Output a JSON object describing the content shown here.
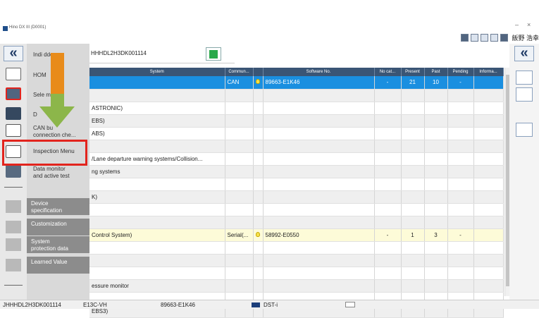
{
  "titlebar": {
    "title": "Hino DX III (D0001)",
    "minimize": "–",
    "close": "×"
  },
  "header_right": {
    "user": "飯野 浩幸"
  },
  "sidebar": {
    "collapse_label": "«",
    "items": [
      {
        "name": "indicator-hidden",
        "label": "Indi      dden"
      },
      {
        "name": "home",
        "label": "HOM"
      },
      {
        "name": "select-system",
        "label": "Sele      m"
      },
      {
        "name": "dtc",
        "label": "D"
      },
      {
        "name": "can-bus",
        "label": "CAN bu\nconnection che..."
      },
      {
        "name": "inspection-menu",
        "label": "Inspection Menu"
      },
      {
        "name": "data-monitor",
        "label": "Data monitor\nand active test"
      }
    ],
    "gray_items": [
      {
        "name": "device-specification",
        "label": "Device\nspecification"
      },
      {
        "name": "customization",
        "label": "Customization"
      },
      {
        "name": "system-protection",
        "label": "System\nprotection data"
      },
      {
        "name": "learned-value",
        "label": "Learned Value"
      }
    ]
  },
  "vin": "HHHDL2H3DK001114",
  "table": {
    "headers": [
      "System",
      "Commun...",
      "",
      "Software No.",
      "No cat...",
      "Present",
      "Past",
      "Pending",
      "Informa..."
    ],
    "rows": [
      {
        "kind": "sel",
        "system": "",
        "comm": "CAN",
        "bulb": true,
        "sw": "89663-E1K46",
        "nocat": "-",
        "present": "21",
        "past": "10",
        "pending": "-",
        "info": ""
      },
      {
        "kind": "alt",
        "system": "",
        "comm": "",
        "bulb": false,
        "sw": "",
        "nocat": "",
        "present": "",
        "past": "",
        "pending": "",
        "info": ""
      },
      {
        "kind": "",
        "system": "ASTRONIC)",
        "comm": "",
        "bulb": false,
        "sw": "",
        "nocat": "",
        "present": "",
        "past": "",
        "pending": "",
        "info": ""
      },
      {
        "kind": "alt",
        "system": "EBS)",
        "comm": "",
        "bulb": false,
        "sw": "",
        "nocat": "",
        "present": "",
        "past": "",
        "pending": "",
        "info": ""
      },
      {
        "kind": "",
        "system": "ABS)",
        "comm": "",
        "bulb": false,
        "sw": "",
        "nocat": "",
        "present": "",
        "past": "",
        "pending": "",
        "info": ""
      },
      {
        "kind": "alt",
        "system": "",
        "comm": "",
        "bulb": false,
        "sw": "",
        "nocat": "",
        "present": "",
        "past": "",
        "pending": "",
        "info": ""
      },
      {
        "kind": "",
        "system": "/Lane departure warning systems/Collision...",
        "comm": "",
        "bulb": false,
        "sw": "",
        "nocat": "",
        "present": "",
        "past": "",
        "pending": "",
        "info": ""
      },
      {
        "kind": "alt",
        "system": "ng systems",
        "comm": "",
        "bulb": false,
        "sw": "",
        "nocat": "",
        "present": "",
        "past": "",
        "pending": "",
        "info": ""
      },
      {
        "kind": "",
        "system": "",
        "comm": "",
        "bulb": false,
        "sw": "",
        "nocat": "",
        "present": "",
        "past": "",
        "pending": "",
        "info": ""
      },
      {
        "kind": "alt",
        "system": "K)",
        "comm": "",
        "bulb": false,
        "sw": "",
        "nocat": "",
        "present": "",
        "past": "",
        "pending": "",
        "info": ""
      },
      {
        "kind": "",
        "system": "",
        "comm": "",
        "bulb": false,
        "sw": "",
        "nocat": "",
        "present": "",
        "past": "",
        "pending": "",
        "info": ""
      },
      {
        "kind": "alt",
        "system": "",
        "comm": "",
        "bulb": false,
        "sw": "",
        "nocat": "",
        "present": "",
        "past": "",
        "pending": "",
        "info": ""
      },
      {
        "kind": "hl",
        "system": "Control System)",
        "comm": "Serial(...",
        "bulb": true,
        "sw": "58992-E0550",
        "nocat": "-",
        "present": "1",
        "past": "3",
        "pending": "-",
        "info": ""
      },
      {
        "kind": "",
        "system": "",
        "comm": "",
        "bulb": false,
        "sw": "",
        "nocat": "",
        "present": "",
        "past": "",
        "pending": "",
        "info": ""
      },
      {
        "kind": "alt",
        "system": "",
        "comm": "",
        "bulb": false,
        "sw": "",
        "nocat": "",
        "present": "",
        "past": "",
        "pending": "",
        "info": ""
      },
      {
        "kind": "",
        "system": "",
        "comm": "",
        "bulb": false,
        "sw": "",
        "nocat": "",
        "present": "",
        "past": "",
        "pending": "",
        "info": ""
      },
      {
        "kind": "alt",
        "system": "essure monitor",
        "comm": "",
        "bulb": false,
        "sw": "",
        "nocat": "",
        "present": "",
        "past": "",
        "pending": "",
        "info": ""
      },
      {
        "kind": "",
        "system": "",
        "comm": "",
        "bulb": false,
        "sw": "",
        "nocat": "",
        "present": "",
        "past": "",
        "pending": "",
        "info": ""
      },
      {
        "kind": "alt",
        "system": "EBS3)",
        "comm": "",
        "bulb": false,
        "sw": "",
        "nocat": "",
        "present": "",
        "past": "",
        "pending": "",
        "info": ""
      }
    ]
  },
  "status": {
    "vin": "JHHHDL2H3DK001114",
    "model": "E13C-VH",
    "software": "89663-E1K46",
    "device": "DST-i"
  },
  "colors": {
    "accent": "#1a8fe0",
    "header": "#3a5575",
    "highlight_box": "#e2241d",
    "arrow_top": "#e88b1a",
    "arrow_bottom": "#8cb64a"
  }
}
